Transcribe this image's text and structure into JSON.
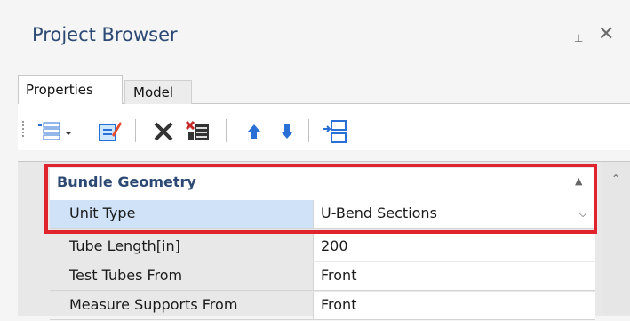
{
  "panel": {
    "title": "Project Browser",
    "pin_glyph": "⊥",
    "close_glyph": "✕"
  },
  "tabs": [
    {
      "label": "Properties",
      "active": true
    },
    {
      "label": "Model",
      "active": false
    }
  ],
  "toolbar": {
    "buttons": [
      {
        "icon": "categorize-dropdown-icon"
      },
      {
        "icon": "edit-properties-icon"
      },
      {
        "icon": "delete-icon"
      },
      {
        "icon": "delete-all-icon"
      },
      {
        "icon": "move-up-icon"
      },
      {
        "icon": "move-down-icon"
      },
      {
        "icon": "split-icon"
      }
    ]
  },
  "property_grid": {
    "category": "Bundle Geometry",
    "rows": [
      {
        "name": "Unit Type",
        "value": "U-Bend Sections",
        "selected": true
      },
      {
        "name": "Tube Length[in]",
        "value": "200",
        "selected": false
      },
      {
        "name": "Test Tubes From",
        "value": "Front",
        "selected": false
      },
      {
        "name": "Measure Supports From",
        "value": "Front",
        "selected": false
      }
    ]
  },
  "colors": {
    "title": "#2c4a74",
    "highlight": "#e0242e",
    "selected_row": "#cfe2f7",
    "edit_icon_accent": "#e84b2c",
    "arrow_blue": "#2a6fd6"
  }
}
